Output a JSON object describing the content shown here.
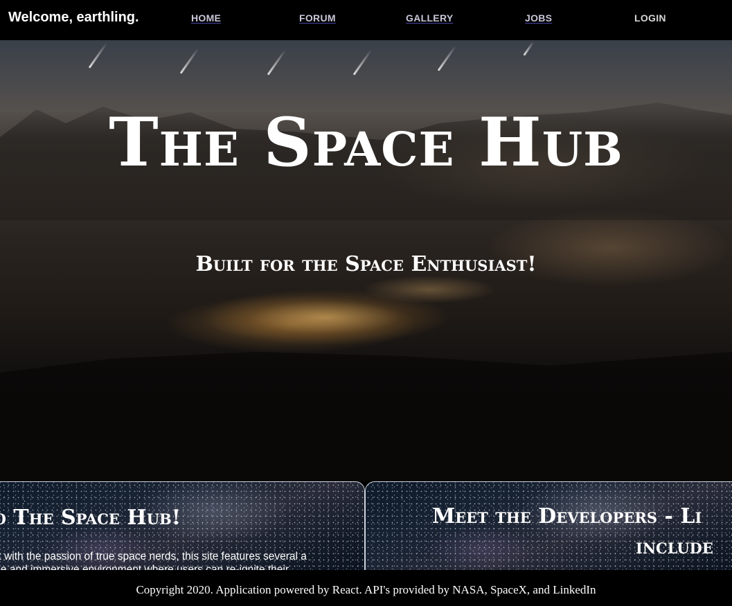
{
  "nav": {
    "brand": "Welcome, earthling.",
    "links": [
      {
        "label": "HOME"
      },
      {
        "label": "FORUM"
      },
      {
        "label": "GALLERY"
      },
      {
        "label": "JOBS"
      },
      {
        "label": "LOGIN"
      }
    ]
  },
  "hero": {
    "title": "The Space Hub",
    "subtitle": "Built for the Space Enthusiast!"
  },
  "cards": [
    {
      "title": "to The Space Hub!",
      "body": "! Built with the passion of true space nerds, this site features several a unique and immersive environment where users can re-ignite their"
    },
    {
      "title_line1": "Meet the Developers - Li",
      "title_line2": "include"
    }
  ],
  "footer": {
    "text": "Copyright 2020. Application powered by React. API's provided by NASA, SpaceX, and LinkedIn"
  }
}
